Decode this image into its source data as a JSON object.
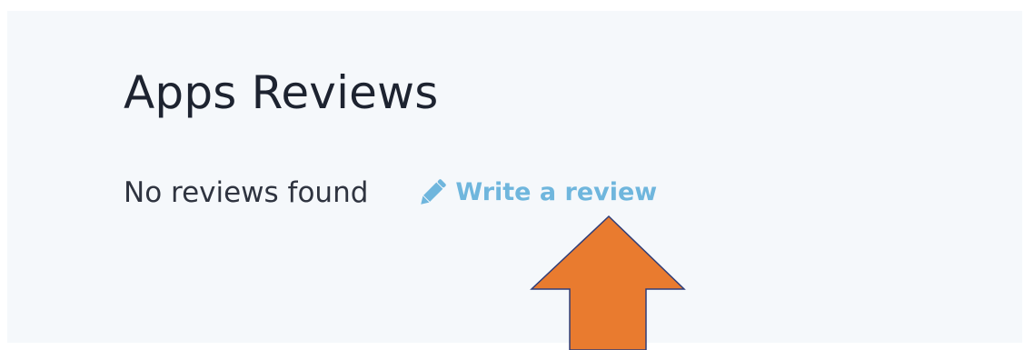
{
  "section": {
    "title": "Apps Reviews"
  },
  "reviews": {
    "empty_message": "No reviews found",
    "write_review_label": "Write a review",
    "write_review_icon": "pencil-icon"
  },
  "colors": {
    "panel_background": "#f5f8fb",
    "link": "#6fb6dd",
    "annotation_arrow_fill": "#e97b2f",
    "annotation_arrow_stroke": "#2f3d78"
  }
}
